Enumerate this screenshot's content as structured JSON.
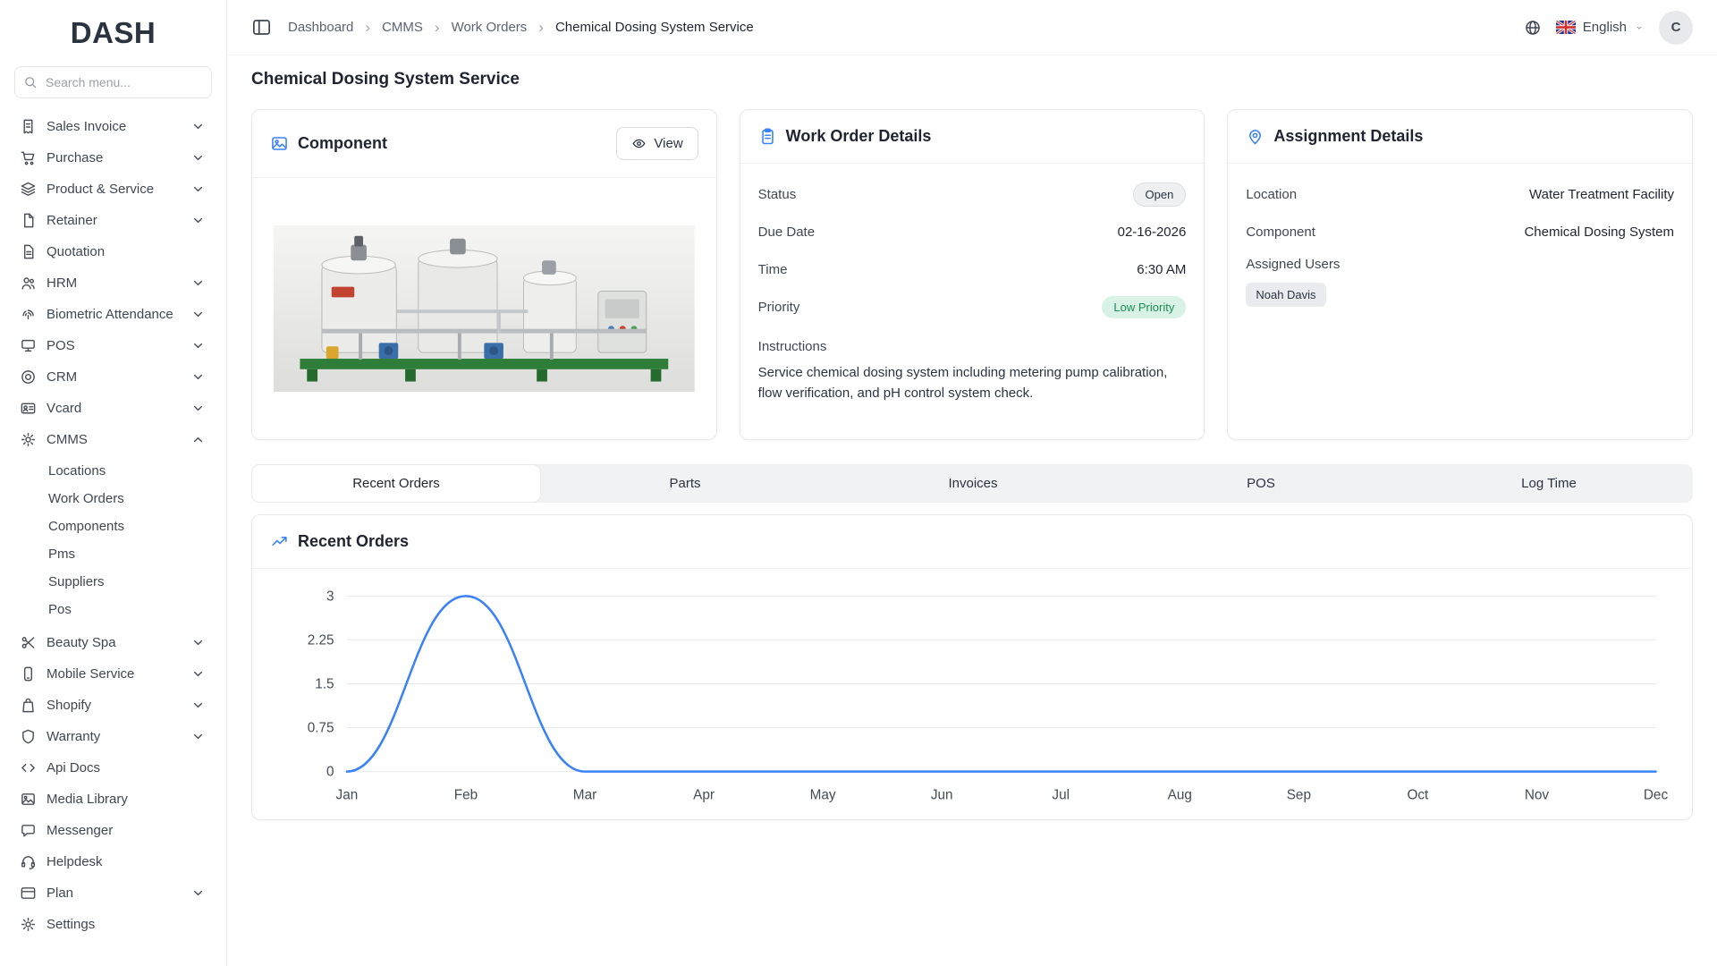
{
  "app": {
    "logo": "DASH"
  },
  "sidebar": {
    "search_placeholder": "Search menu...",
    "items": [
      {
        "label": "Sales Invoice",
        "icon": "sales-invoice",
        "expandable": true
      },
      {
        "label": "Purchase",
        "icon": "purchase",
        "expandable": true
      },
      {
        "label": "Product & Service",
        "icon": "product-service",
        "expandable": true
      },
      {
        "label": "Retainer",
        "icon": "retainer",
        "expandable": true
      },
      {
        "label": "Quotation",
        "icon": "quotation",
        "expandable": false
      },
      {
        "label": "HRM",
        "icon": "hrm",
        "expandable": true
      },
      {
        "label": "Biometric Attendance",
        "icon": "biometric",
        "expandable": true
      },
      {
        "label": "POS",
        "icon": "pos",
        "expandable": true
      },
      {
        "label": "CRM",
        "icon": "crm",
        "expandable": true
      },
      {
        "label": "Vcard",
        "icon": "vcard",
        "expandable": true
      },
      {
        "label": "CMMS",
        "icon": "cmms",
        "expandable": true,
        "expanded": true,
        "children": [
          "Locations",
          "Work Orders",
          "Components",
          "Pms",
          "Suppliers",
          "Pos"
        ]
      },
      {
        "label": "Beauty Spa",
        "icon": "beauty-spa",
        "expandable": true
      },
      {
        "label": "Mobile Service",
        "icon": "mobile-service",
        "expandable": true
      },
      {
        "label": "Shopify",
        "icon": "shopify",
        "expandable": true
      },
      {
        "label": "Warranty",
        "icon": "warranty",
        "expandable": true
      },
      {
        "label": "Api Docs",
        "icon": "api-docs",
        "expandable": false
      },
      {
        "label": "Media Library",
        "icon": "media-library",
        "expandable": false
      },
      {
        "label": "Messenger",
        "icon": "messenger",
        "expandable": false
      },
      {
        "label": "Helpdesk",
        "icon": "helpdesk",
        "expandable": false
      },
      {
        "label": "Plan",
        "icon": "plan",
        "expandable": true
      },
      {
        "label": "Settings",
        "icon": "settings",
        "expandable": false
      }
    ]
  },
  "header": {
    "breadcrumb": [
      "Dashboard",
      "CMMS",
      "Work Orders",
      "Chemical Dosing System Service"
    ],
    "language": "English",
    "avatar_initial": "C"
  },
  "page": {
    "title": "Chemical Dosing System Service"
  },
  "cards": {
    "component": {
      "title": "Component",
      "view_button": "View"
    },
    "work_order": {
      "title": "Work Order Details",
      "fields": [
        {
          "label": "Status",
          "value": "Open",
          "type": "badge"
        },
        {
          "label": "Due Date",
          "value": "02-16-2026",
          "type": "text"
        },
        {
          "label": "Time",
          "value": "6:30 AM",
          "type": "text"
        },
        {
          "label": "Priority",
          "value": "Low Priority",
          "type": "badge-green"
        }
      ],
      "instructions_label": "Instructions",
      "instructions_text": "Service chemical dosing system including metering pump calibration, flow verification, and pH control system check."
    },
    "assignment": {
      "title": "Assignment Details",
      "fields": [
        {
          "label": "Location",
          "value": "Water Treatment Facility",
          "type": "text"
        },
        {
          "label": "Component",
          "value": "Chemical Dosing System",
          "type": "text"
        }
      ],
      "assigned_users_label": "Assigned Users",
      "assigned_users": [
        "Noah Davis"
      ]
    }
  },
  "tabs": [
    "Recent Orders",
    "Parts",
    "Invoices",
    "POS",
    "Log Time"
  ],
  "active_tab": "Recent Orders",
  "chart_section": {
    "title": "Recent Orders"
  },
  "chart_data": {
    "type": "line",
    "title": "Recent Orders",
    "categories": [
      "Jan",
      "Feb",
      "Mar",
      "Apr",
      "May",
      "Jun",
      "Jul",
      "Aug",
      "Sep",
      "Oct",
      "Nov",
      "Dec"
    ],
    "series": [
      {
        "name": "Orders",
        "values": [
          0,
          3,
          0,
          0,
          0,
          0,
          0,
          0,
          0,
          0,
          0,
          0
        ]
      }
    ],
    "yticks": [
      0,
      0.75,
      1.5,
      2.25,
      3
    ],
    "ylim": [
      0,
      3
    ],
    "grid": true,
    "legend": "none",
    "line_color": "#3b82f6"
  },
  "colors": {
    "accent": "#3b82f6",
    "badge_green_bg": "#d8f3e5",
    "badge_green_text": "#1d8a55"
  }
}
